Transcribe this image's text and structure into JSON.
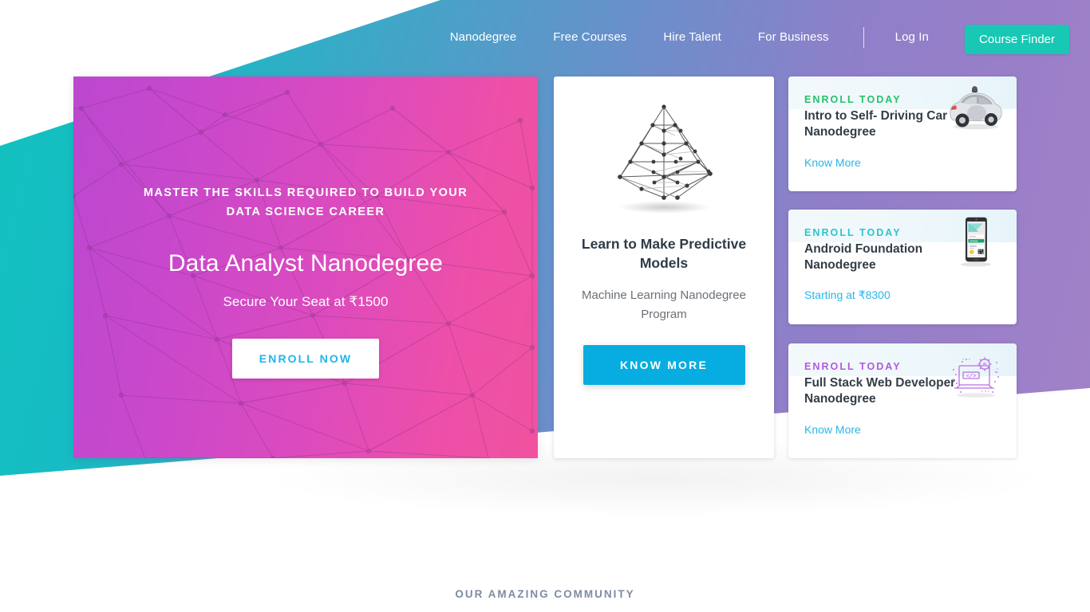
{
  "nav": {
    "links": [
      {
        "label": "Nanodegree"
      },
      {
        "label": "Free Courses"
      },
      {
        "label": "Hire Talent"
      },
      {
        "label": "For Business"
      }
    ],
    "login_label": "Log In",
    "cta_label": "Course Finder",
    "cta_color": "#18c8b4"
  },
  "hero": {
    "kicker": "MASTER THE SKILLS REQUIRED TO BUILD YOUR DATA SCIENCE CAREER",
    "title": "Data Analyst Nanodegree",
    "subtitle": "Secure Your Seat at ₹1500",
    "button_label": "ENROLL NOW",
    "button_text_color": "#1fb6e8",
    "gradient_from": "#bb48cf",
    "gradient_to": "#f0529f"
  },
  "feature_card": {
    "illustration": "pyramid-network-icon",
    "title": "Learn to Make Predictive Models",
    "subtitle": "Machine Learning Nanodegree Program",
    "button_label": "KNOW MORE",
    "button_color": "#07ade0"
  },
  "course_cards": [
    {
      "kicker": "ENROLL TODAY",
      "kicker_color": "#25c16a",
      "title": "Intro to Self- Driving Car Nanodegree",
      "link_label": "Know More",
      "icon": "self-driving-car-icon"
    },
    {
      "kicker": "ENROLL TODAY",
      "kicker_color": "#2bc4cf",
      "title": "Android Foundation Nanodegree",
      "link_label": "Starting at ₹8300",
      "icon": "android-phone-icon"
    },
    {
      "kicker": "ENROLL TODAY",
      "kicker_color": "#b558e0",
      "title": "Full Stack Web Developer Nanodegree",
      "link_label": "Know More",
      "icon": "web-developer-laptop-icon"
    }
  ],
  "community": {
    "heading": "OUR AMAZING COMMUNITY"
  }
}
